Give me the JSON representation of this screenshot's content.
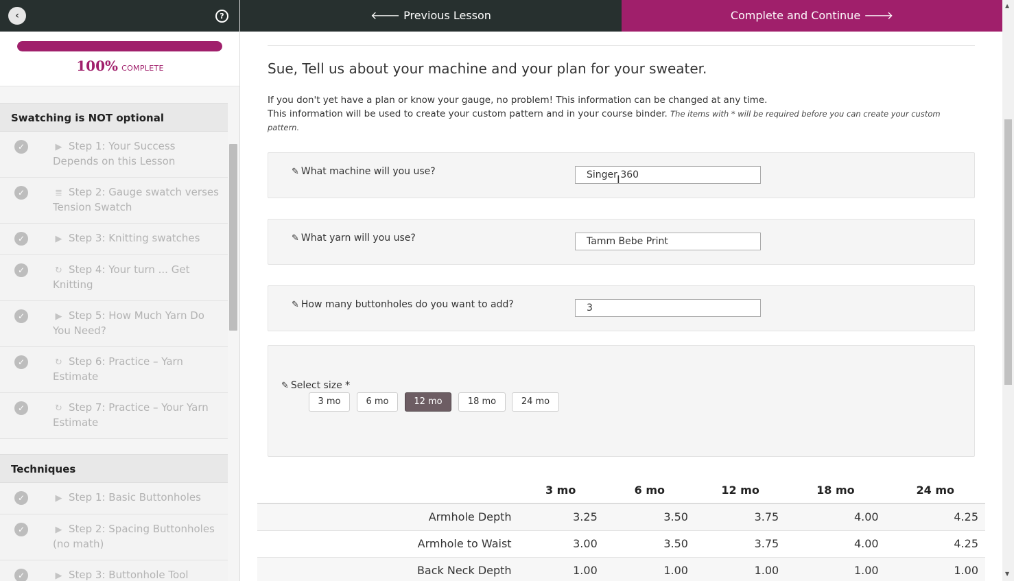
{
  "sidebar": {
    "back_icon": "chevron-left-icon",
    "help_icon": "question-circle-icon",
    "help_glyph": "?",
    "progress_fraction": 1.0,
    "progress_percent": "100%",
    "progress_label": "COMPLETE",
    "sections": [
      {
        "title": "Swatching is NOT optional",
        "lessons": [
          {
            "type_icon": "video-icon",
            "glyph": "▶",
            "label": "Step 1: Your Success Depends on this Lesson"
          },
          {
            "type_icon": "document-icon",
            "glyph": "≣",
            "label": "Step 2: Gauge swatch verses Tension Swatch"
          },
          {
            "type_icon": "video-icon",
            "glyph": "▶",
            "label": "Step 3: Knitting swatches"
          },
          {
            "type_icon": "refresh-icon",
            "glyph": "↻",
            "label": "Step 4: Your turn ... Get Knitting"
          },
          {
            "type_icon": "video-icon",
            "glyph": "▶",
            "label": "Step 5: How Much Yarn Do You Need?"
          },
          {
            "type_icon": "refresh-icon",
            "glyph": "↻",
            "label": "Step 6: Practice – Yarn Estimate"
          },
          {
            "type_icon": "refresh-icon",
            "glyph": "↻",
            "label": "Step 7: Practice – Your Yarn Estimate"
          }
        ]
      },
      {
        "title": "Techniques",
        "lessons": [
          {
            "type_icon": "video-icon",
            "glyph": "▶",
            "label": "Step 1: Basic Buttonholes"
          },
          {
            "type_icon": "video-icon",
            "glyph": "▶",
            "label": "Step 2: Spacing Buttonholes (no math)"
          },
          {
            "type_icon": "video-icon",
            "glyph": "▶",
            "label": "Step 3: Buttonhole Tool"
          }
        ]
      }
    ]
  },
  "topbar": {
    "prev_label": "Previous Lesson",
    "next_label": "Complete and Continue"
  },
  "main": {
    "title": "Sue, Tell us about your machine and your plan for your sweater.",
    "intro_line1": "If you don't yet have a plan or know your gauge, no problem!  This information can be changed at any time.",
    "intro_line2": "This information will be used to create your custom pattern and in your course binder.",
    "intro_note": "The items with * will be required before you can create your custom pattern.",
    "questions": [
      {
        "label": "What machine will you use?",
        "value": "Singer 360"
      },
      {
        "label": "What yarn will you use?",
        "value": "Tamm Bebe Print"
      },
      {
        "label": "How many buttonholes do you want to add?",
        "value": "3"
      }
    ],
    "size": {
      "label": "Select size *",
      "options": [
        "3 mo",
        "6 mo",
        "12 mo",
        "18 mo",
        "24 mo"
      ],
      "selected": "12 mo"
    },
    "table": {
      "headers": [
        "3 mo",
        "6 mo",
        "12 mo",
        "18 mo",
        "24 mo"
      ],
      "rows": [
        {
          "label": "Armhole Depth",
          "values": [
            "3.25",
            "3.50",
            "3.75",
            "4.00",
            "4.25"
          ]
        },
        {
          "label": "Armhole to Waist",
          "values": [
            "3.00",
            "3.50",
            "3.75",
            "4.00",
            "4.25"
          ]
        },
        {
          "label": "Back Neck Depth",
          "values": [
            "1.00",
            "1.00",
            "1.00",
            "1.00",
            "1.00"
          ]
        }
      ]
    }
  }
}
